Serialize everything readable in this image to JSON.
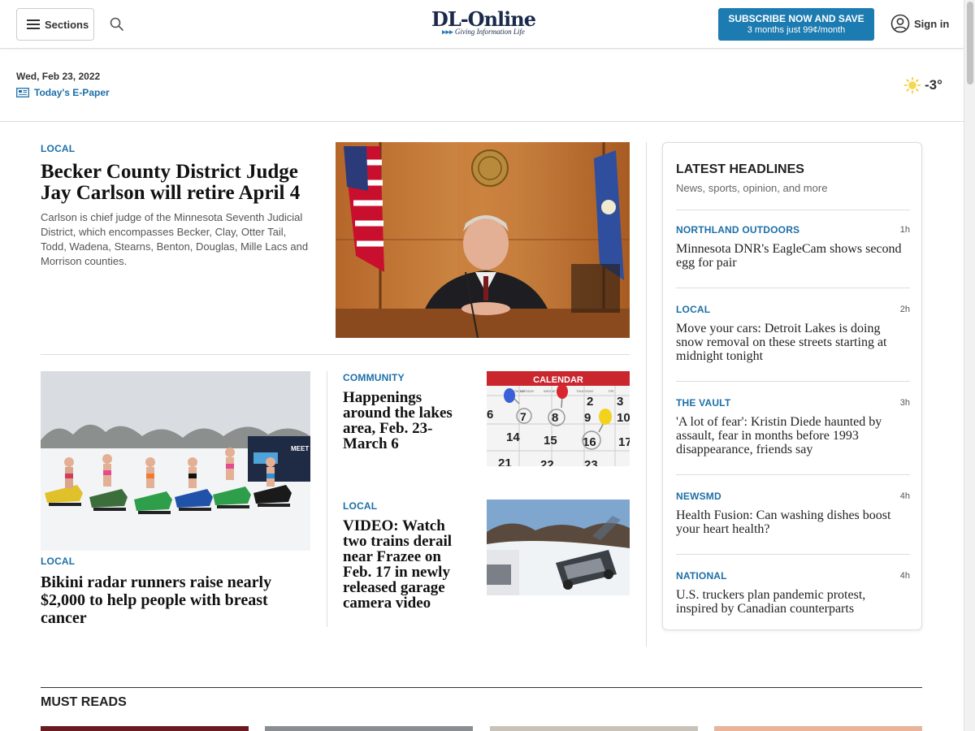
{
  "header": {
    "sections_label": "Sections",
    "logo_main": "DL-Online",
    "logo_tagline": "Giving Information Life",
    "subscribe_line1": "SUBSCRIBE NOW AND SAVE",
    "subscribe_line2": "3 months just 99¢/month",
    "signin_label": "Sign in"
  },
  "datestrip": {
    "date": "Wed, Feb 23, 2022",
    "epaper_label": "Today's E-Paper",
    "temperature": "-3°"
  },
  "lead": {
    "kicker": "LOCAL",
    "headline": "Becker County District Judge Jay Carlson will retire April 4",
    "summary": "Carlson is chief judge of the Minnesota Seventh Judicial District, which encompasses Becker, Clay, Otter Tail, Todd, Wadena, Stearns, Benton, Douglas, Mille Lacs and Morrison counties."
  },
  "stories": [
    {
      "kicker": "LOCAL",
      "headline": "Bikini radar runners raise nearly $2,000 to help people with breast cancer"
    },
    {
      "kicker": "COMMUNITY",
      "headline": "Happenings around the lakes area, Feb. 23-March 6"
    },
    {
      "kicker": "LOCAL",
      "headline": "VIDEO: Watch two trains derail near Frazee on Feb. 17 in newly released garage camera video"
    }
  ],
  "calendar_image": {
    "title": "CALENDAR",
    "days": [
      "MONDAY",
      "TUESDAY",
      "WEDNE",
      "THURSDAY",
      "FRI"
    ],
    "numbers": [
      "2",
      "3",
      "6",
      "7",
      "8",
      "9",
      "10",
      "14",
      "15",
      "16",
      "17",
      "21",
      "22",
      "23"
    ]
  },
  "billboard_text": "MEET Y",
  "latest": {
    "title": "LATEST HEADLINES",
    "subtitle": "News, sports, opinion, and more",
    "items": [
      {
        "kicker": "NORTHLAND OUTDOORS",
        "time": "1h",
        "headline": "Minnesota DNR's EagleCam shows second egg for pair"
      },
      {
        "kicker": "LOCAL",
        "time": "2h",
        "headline": "Move your cars: Detroit Lakes is doing snow removal on these streets starting at midnight tonight"
      },
      {
        "kicker": "THE VAULT",
        "time": "3h",
        "headline": "'A lot of fear': Kristin Diede haunted by assault, fear in months before 1993 disappearance, friends say"
      },
      {
        "kicker": "NEWSMD",
        "time": "4h",
        "headline": "Health Fusion: Can washing dishes boost your heart health?"
      },
      {
        "kicker": "NATIONAL",
        "time": "4h",
        "headline": "U.S. truckers plan pandemic protest, inspired by Canadian counterparts"
      }
    ]
  },
  "must_reads": {
    "title": "MUST READS"
  },
  "colors": {
    "accent": "#1c6fa8",
    "subscribe_bg": "#1c7bb0"
  },
  "icons": [
    "hamburger-icon",
    "search-icon",
    "user-circle-icon",
    "newspaper-icon",
    "sun-icon"
  ]
}
